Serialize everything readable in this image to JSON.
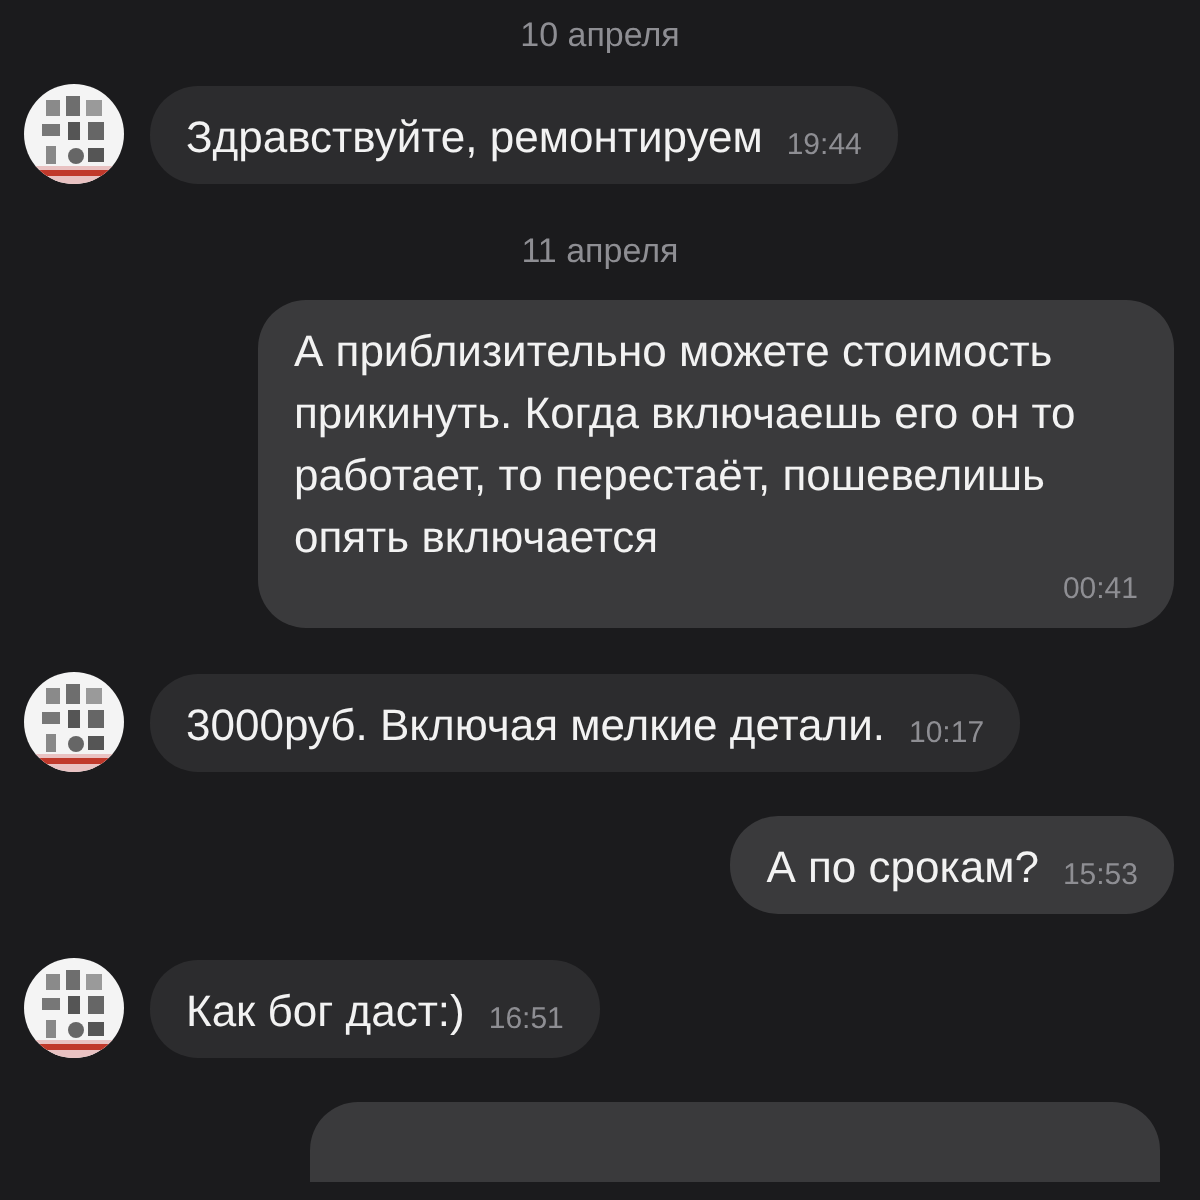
{
  "messages": [
    {
      "kind": "date",
      "text": "10 апреля"
    },
    {
      "kind": "incoming",
      "text": "Здравствуйте, ремонтируем",
      "time": "19:44"
    },
    {
      "kind": "date",
      "text": "11 апреля"
    },
    {
      "kind": "outgoing",
      "text": "А приблизительно можете стоимость прикинуть. Когда включаешь его он то работает, то перестаёт, пошевелишь опять включается",
      "time": "00:41"
    },
    {
      "kind": "incoming",
      "text": "3000руб. Включая мелкие детали.",
      "time": "10:17"
    },
    {
      "kind": "outgoing",
      "text": "А по срокам?",
      "time": "15:53"
    },
    {
      "kind": "incoming",
      "text": "Как бог даст:)",
      "time": "16:51"
    },
    {
      "kind": "outgoing_cut"
    }
  ]
}
